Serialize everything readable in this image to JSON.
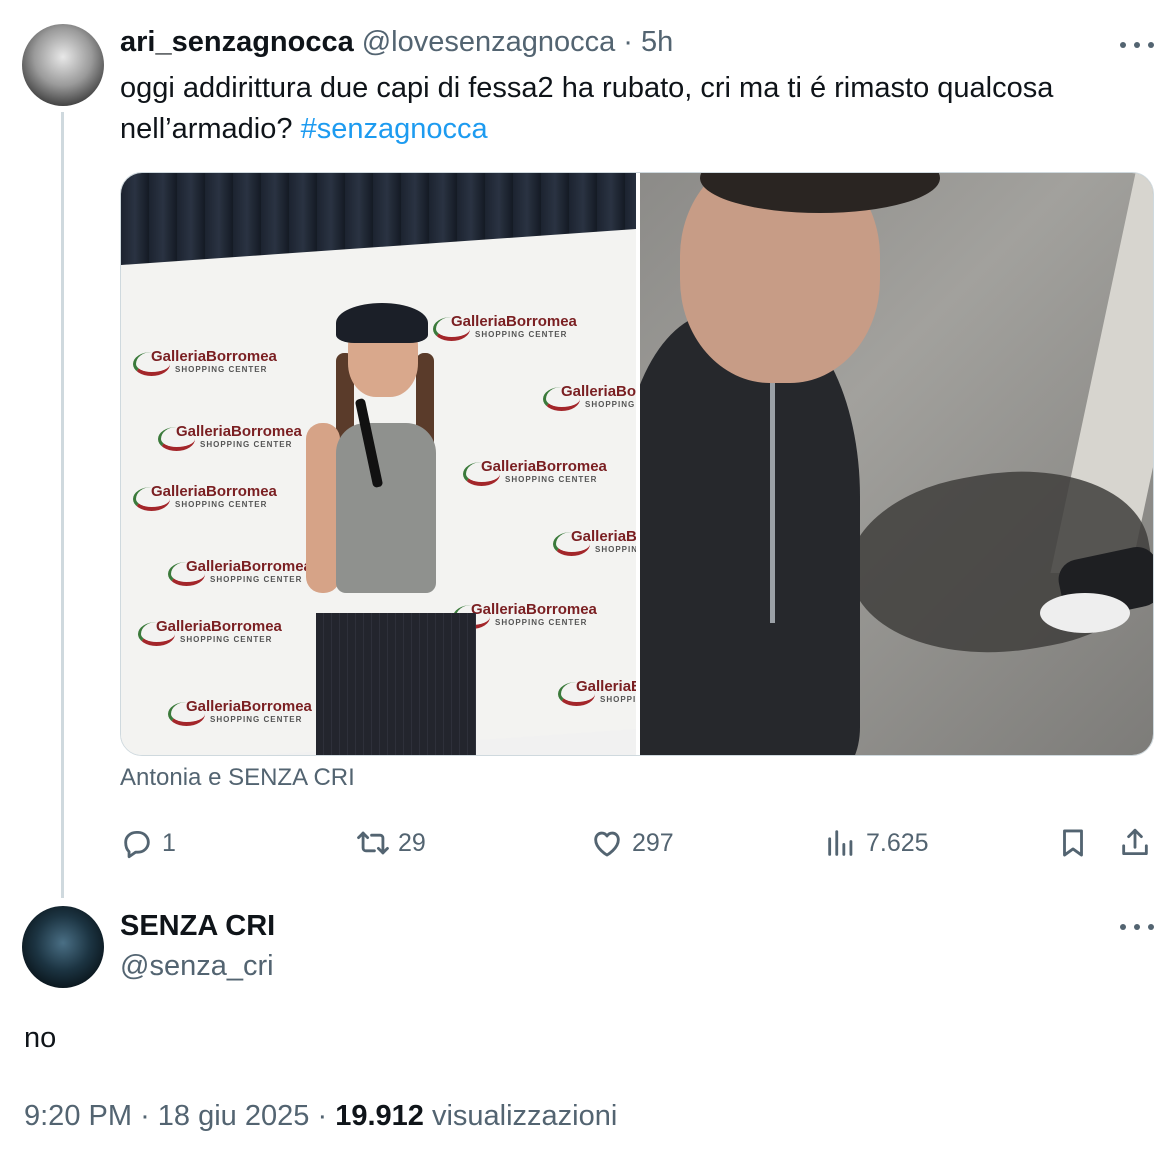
{
  "tweet": {
    "display_name": "ari_senzagnocca",
    "handle": "@lovesenzagnocca",
    "separator": "·",
    "time_ago": "5h",
    "text": "oggi addirittura due capi di fessa2 ha rubato, cri ma ti é rimasto qualcosa nell’armadio?",
    "hashtag": "#senzagnocca",
    "media_caption": "Antonia e SENZA CRI",
    "backdrop_logo": "GalleriaBorromea",
    "backdrop_logo_sub": "SHOPPING CENTER",
    "actions": {
      "replies": "1",
      "retweets": "29",
      "likes": "297",
      "views": "7.625"
    }
  },
  "reply": {
    "display_name": "SENZA CRI",
    "handle": "@senza_cri",
    "text": "no",
    "time": "9:20 PM",
    "date": "18 giu 2025",
    "separator": "·",
    "views_count": "19.912",
    "views_label": "visualizzazioni"
  },
  "colors": {
    "accent": "#1d9bf0",
    "muted": "#536471",
    "text": "#0f1419",
    "thread_line": "#cfd9de"
  },
  "icons": [
    "more-icon",
    "reply-icon",
    "retweet-icon",
    "like-icon",
    "views-icon",
    "bookmark-icon",
    "share-icon"
  ]
}
